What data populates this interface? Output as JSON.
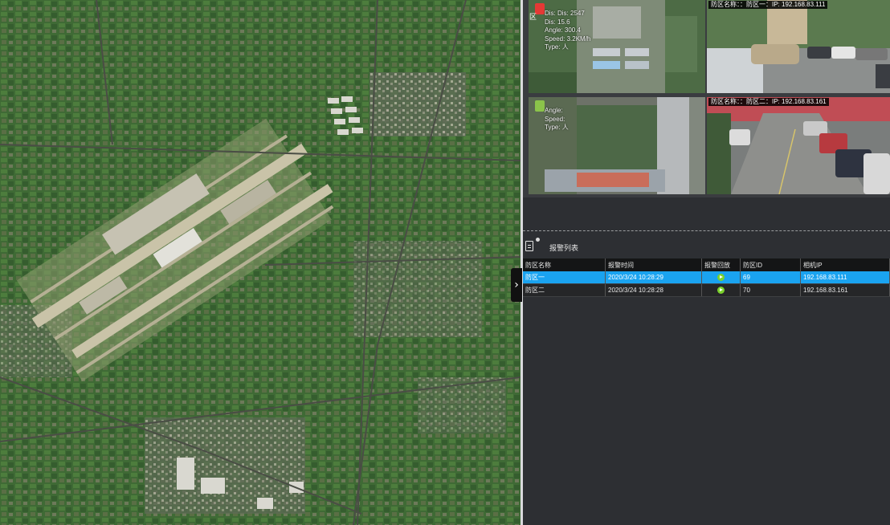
{
  "map": {
    "collapse_glyph": "›"
  },
  "videos": [
    {
      "type": "drone",
      "info": [
        "Dis: Dis: 2547",
        "Dis: 15.6",
        "Angle: 300.4",
        "Speed: 3.2KM/h",
        "Type: 人"
      ],
      "edge_char": "区",
      "badge_color": "#e53935"
    },
    {
      "type": "camera",
      "caption": "防区名称：：防区一：IP: 192.168.83.111"
    },
    {
      "type": "drone",
      "info": [
        "Angle:",
        "Speed:",
        "Type: 人"
      ],
      "badge_color": "#8bc34a"
    },
    {
      "type": "camera",
      "caption": "防区名称：：防区二：IP: 192.168.83.161"
    }
  ],
  "alarm_list": {
    "title": "报警列表",
    "columns": [
      "防区名称",
      "报警时间",
      "报警回放",
      "防区ID",
      "相机IP"
    ],
    "rows": [
      {
        "zone": "防区一",
        "time": "2020/3/24 10:28:29",
        "zone_id": "69",
        "camera_ip": "192.168.83.111",
        "selected": true
      },
      {
        "zone": "防区二",
        "time": "2020/3/24 10:28:28",
        "zone_id": "70",
        "camera_ip": "192.168.83.161",
        "selected": false
      }
    ]
  },
  "colors": {
    "selected_row": "#1aa3f0",
    "play_icon": "#7bd12c",
    "panel_bg": "#2d2f33"
  }
}
